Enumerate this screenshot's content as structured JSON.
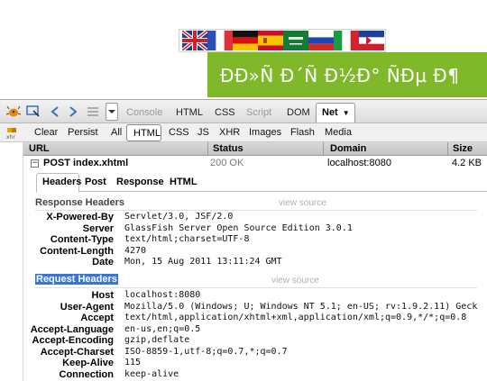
{
  "page": {
    "flags": [
      "uk-flag-icon",
      "france-flag-icon",
      "germany-flag-icon",
      "spain-flag-icon",
      "saudi-flag-icon",
      "russia-flag-icon",
      "italy-flag-icon",
      "serbia-flag-icon"
    ],
    "banner_text": "ÐÐ»Ñ Ð´Ñ Ð½Ð° ÑÐµ Ð¶",
    "banner_color": "#7fb829"
  },
  "toolbar": {
    "tabs": [
      "Console",
      "HTML",
      "CSS",
      "Script",
      "DOM"
    ],
    "active_tab": "Net",
    "filters": {
      "clear": "Clear",
      "persist": "Persist",
      "types": [
        "All",
        "HTML",
        "CSS",
        "JS",
        "XHR",
        "Images",
        "Flash",
        "Media"
      ],
      "selected": "HTML"
    },
    "xhr_label": "xhr"
  },
  "columns": {
    "url": "URL",
    "status": "Status",
    "domain": "Domain",
    "size": "Size"
  },
  "request": {
    "method_url": "POST index.xhtml",
    "status": "200 OK",
    "domain": "localhost:8080",
    "size": "4.2 KB"
  },
  "detail_tabs": [
    "Headers",
    "Post",
    "Response",
    "HTML"
  ],
  "response_headers": {
    "title": "Response Headers",
    "view_source": "view source",
    "rows": [
      {
        "name": "X-Powered-By",
        "value": "Servlet/3.0, JSF/2.0"
      },
      {
        "name": "Server",
        "value": "GlassFish Server Open Source Edition 3.0.1"
      },
      {
        "name": "Content-Type",
        "value": "text/html;charset=UTF-8"
      },
      {
        "name": "Content-Length",
        "value": "4270"
      },
      {
        "name": "Date",
        "value": "Mon, 15 Aug 2011 13:11:24 GMT"
      }
    ]
  },
  "request_headers": {
    "title": "Request Headers",
    "view_source": "view source",
    "rows": [
      {
        "name": "Host",
        "value": "localhost:8080"
      },
      {
        "name": "User-Agent",
        "value": "Mozilla/5.0 (Windows; U; Windows NT 5.1; en-US; rv:1.9.2.11) Geck"
      },
      {
        "name": "Accept",
        "value": "text/html,application/xhtml+xml,application/xml;q=0.9,*/*;q=0.8"
      },
      {
        "name": "Accept-Language",
        "value": "en-us,en;q=0.5"
      },
      {
        "name": "Accept-Encoding",
        "value": "gzip,deflate"
      },
      {
        "name": "Accept-Charset",
        "value": "ISO-8859-1,utf-8;q=0.7,*;q=0.7"
      },
      {
        "name": "Keep-Alive",
        "value": "115"
      },
      {
        "name": "Connection",
        "value": "keep-alive"
      }
    ]
  }
}
